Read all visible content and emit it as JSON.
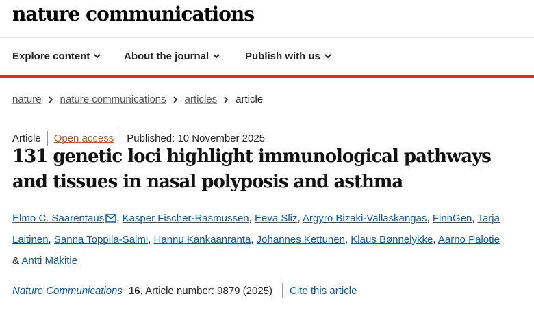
{
  "header": {
    "logo": "nature communications"
  },
  "nav": {
    "items": [
      {
        "label": "Explore content"
      },
      {
        "label": "About the journal"
      },
      {
        "label": "Publish with us"
      }
    ]
  },
  "breadcrumb": {
    "items": [
      "nature",
      "nature communications",
      "articles"
    ],
    "current": "article"
  },
  "article": {
    "type": "Article",
    "access": "Open access",
    "published": "Published: 10 November 2025",
    "title": "131 genetic loci highlight immunological pathways and tissues in nasal polyposis and asthma",
    "authors": [
      "Elmo C. Saarentaus",
      "Kasper Fischer-Rasmussen",
      "Eeva Sliz",
      "Argyro Bizaki-Vallaskangas",
      "FinnGen",
      "Tarja Laitinen",
      "Sanna Toppila-Salmi",
      "Hannu Kankaanranta",
      "Johannes Kettunen",
      "Klaus Bønnelykke",
      "Aarno Palotie",
      "Antti Mäkitie"
    ],
    "authors_last_joiner": "&",
    "journal": "Nature Communications",
    "volume": "16",
    "article_number": ", Article number: 9879 (2025)",
    "cite_label": "Cite this article"
  },
  "icons": {
    "mail": "envelope-icon",
    "chevron": "chevron-down-icon",
    "breadcrumb_sep": "chevron-right-icon"
  },
  "colors": {
    "accent": "#c0392b",
    "link": "#0b5aa2",
    "open_access": "#b95b1a"
  }
}
